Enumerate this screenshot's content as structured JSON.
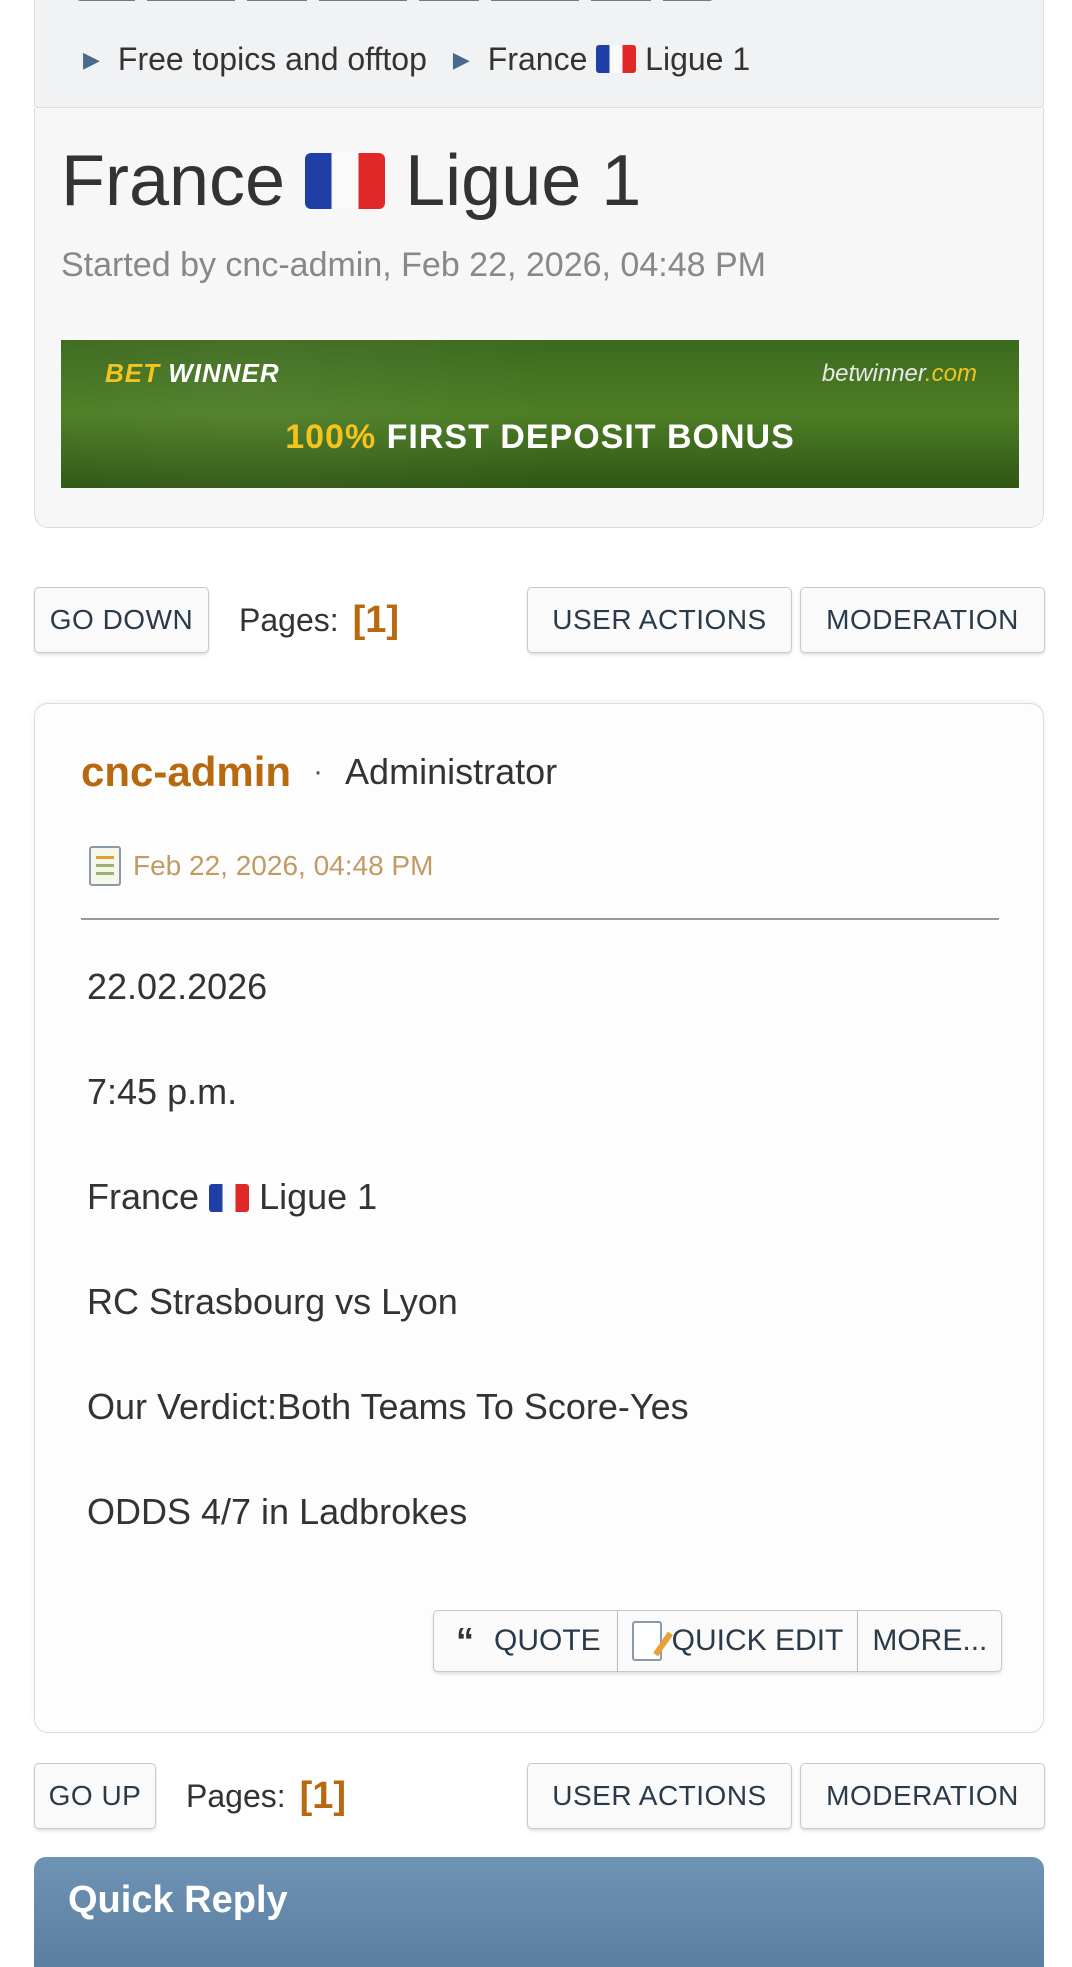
{
  "breadcrumb": {
    "items": [
      {
        "label": "Free topics and offtop"
      },
      {
        "label_pre": "France",
        "label_post": "Ligue 1"
      }
    ]
  },
  "topic": {
    "title_pre": "France",
    "title_post": "Ligue 1",
    "meta": "Started by cnc-admin, Feb 22, 2026, 04:48 PM"
  },
  "banner": {
    "brand_bet": "BET",
    "brand_winner": "WINNER",
    "site_main": "betwinner",
    "site_domain": ".com",
    "pct": "100%",
    "text": "FIRST DEPOSIT BONUS"
  },
  "top_bar": {
    "go_label": "GO DOWN",
    "pages_label": "Pages:",
    "page_current": "[1]",
    "user_actions": "USER ACTIONS",
    "moderation": "MODERATION"
  },
  "post": {
    "author": "cnc-admin",
    "separator": "·",
    "role": "Administrator",
    "date": "Feb 22, 2026, 04:48 PM",
    "lines": [
      "22.02.2026",
      "7:45 p.m.",
      "France 🇫🇷 Ligue 1",
      "RC Strasbourg vs Lyon",
      "Our Verdict:Both Teams To Score-Yes",
      "ODDS 4/7 in Ladbrokes"
    ],
    "line3_pre": "France",
    "line3_post": "Ligue 1",
    "actions": {
      "quote": "QUOTE",
      "quick_edit": "QUICK EDIT",
      "more": "MORE..."
    }
  },
  "bottom_bar": {
    "go_label": "GO UP",
    "pages_label": "Pages:",
    "page_current": "[1]",
    "user_actions": "USER ACTIONS",
    "moderation": "MODERATION"
  },
  "quick_reply": {
    "title": "Quick Reply"
  },
  "colors": {
    "accent": "#b8690f",
    "header_blue": "#5a7fa1",
    "date_tan": "#c29a64",
    "flag_blue": "#1f3fa6",
    "flag_red": "#e02828"
  }
}
